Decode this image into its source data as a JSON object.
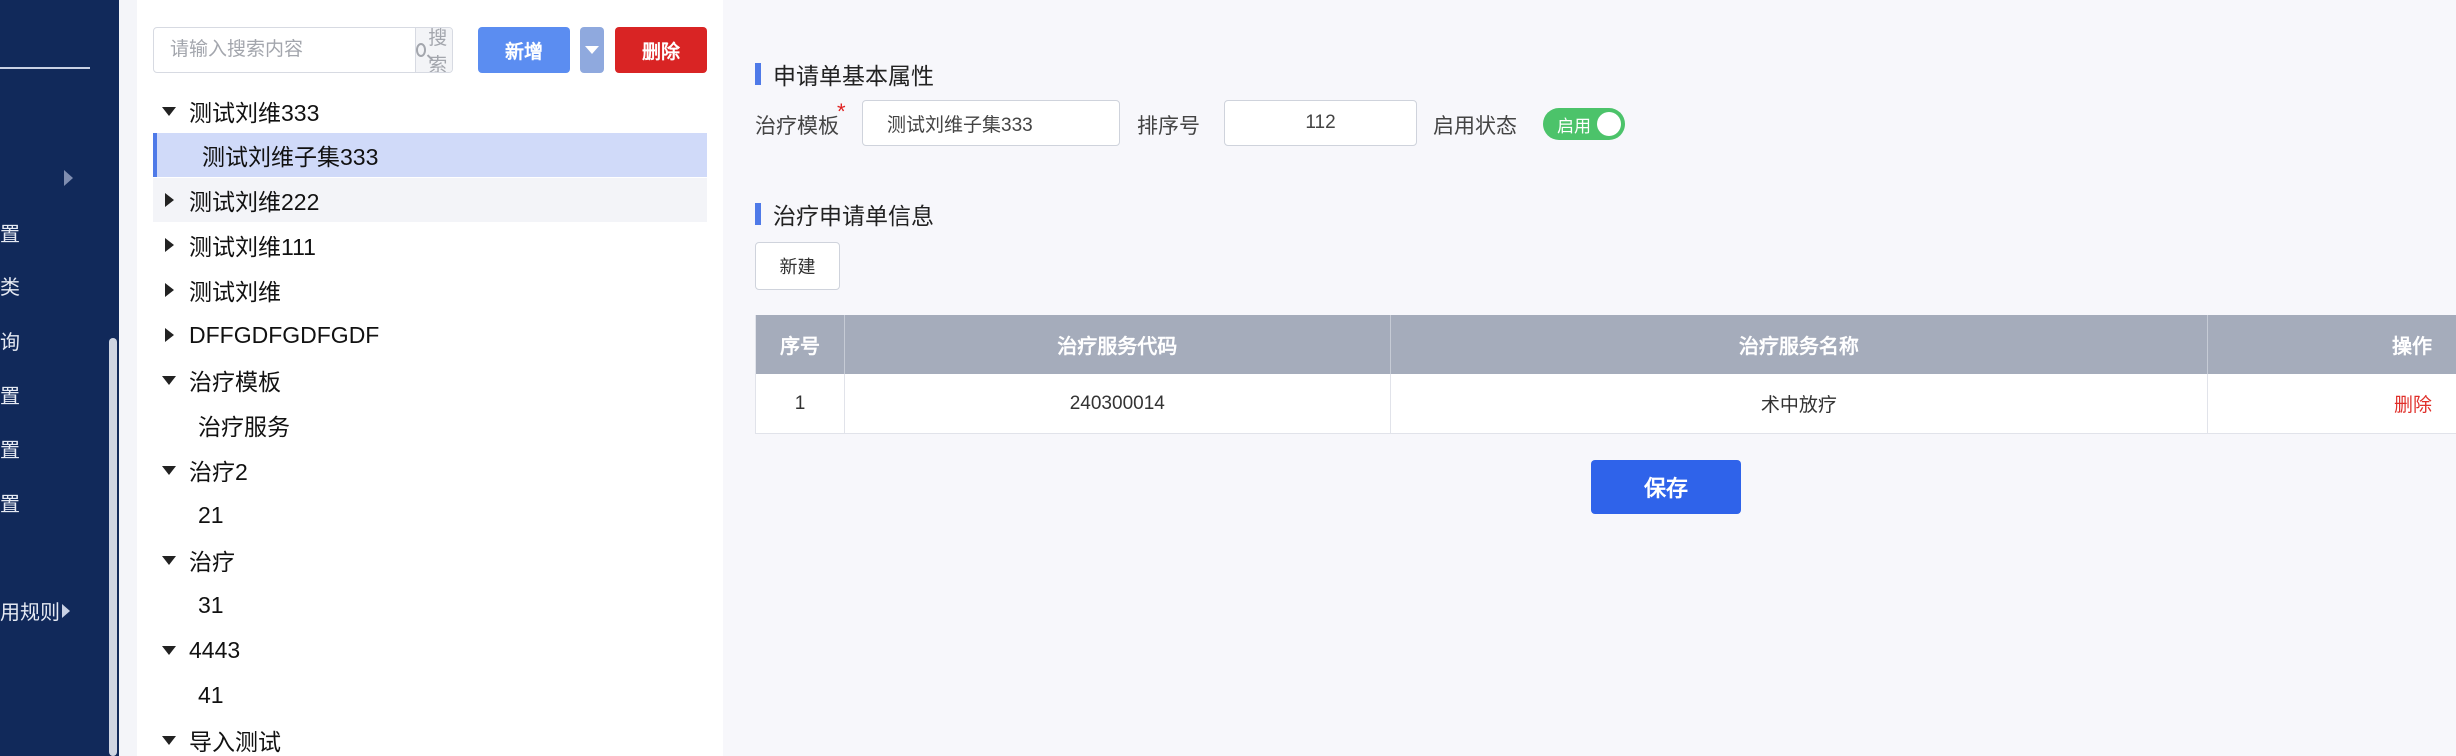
{
  "sidebar": {
    "items": [
      {
        "label": "置"
      },
      {
        "label": "类"
      },
      {
        "label": "询"
      },
      {
        "label": "置"
      },
      {
        "label": "置"
      },
      {
        "label": "置"
      },
      {
        "label": "用规则"
      }
    ]
  },
  "tree_panel": {
    "search": {
      "placeholder": "请输入搜索内容",
      "button_label": "搜索"
    },
    "buttons": {
      "add": "新增",
      "delete": "删除"
    },
    "nodes": [
      {
        "label": "测试刘维333",
        "expanded": true
      },
      {
        "label": "测试刘维子集333",
        "selected": true
      },
      {
        "label": "测试刘维222",
        "expanded": false
      },
      {
        "label": "测试刘维111",
        "expanded": false
      },
      {
        "label": "测试刘维",
        "expanded": false
      },
      {
        "label": "DFFGDFGDFGDF",
        "expanded": false
      },
      {
        "label": "治疗模板",
        "expanded": true
      },
      {
        "label": "治疗服务"
      },
      {
        "label": "治疗2",
        "expanded": true
      },
      {
        "label": "21"
      },
      {
        "label": "治疗",
        "expanded": true
      },
      {
        "label": "31"
      },
      {
        "label": "4443",
        "expanded": true
      },
      {
        "label": "41"
      },
      {
        "label": "导入测试",
        "expanded": true
      }
    ]
  },
  "main": {
    "basic_section_title": "申请单基本属性",
    "template_label": "治疗模板",
    "template_value": "测试刘维子集333",
    "sort_label": "排序号",
    "sort_value": "112",
    "status_label": "启用状态",
    "status_toggle_label": "启用",
    "status_enabled": true,
    "info_section_title": "治疗申请单信息",
    "new_button": "新建",
    "table": {
      "headers": [
        "序号",
        "治疗服务代码",
        "治疗服务名称",
        "操作"
      ],
      "rows": [
        {
          "index": "1",
          "code": "240300014",
          "name": "术中放疗",
          "action": "删除"
        }
      ]
    },
    "save_button": "保存"
  },
  "colors": {
    "sidebar_bg": "#11295a",
    "accent": "#4f7ae8",
    "danger": "#d92424",
    "save": "#2f63ea",
    "toggle_on": "#4cc36a"
  }
}
